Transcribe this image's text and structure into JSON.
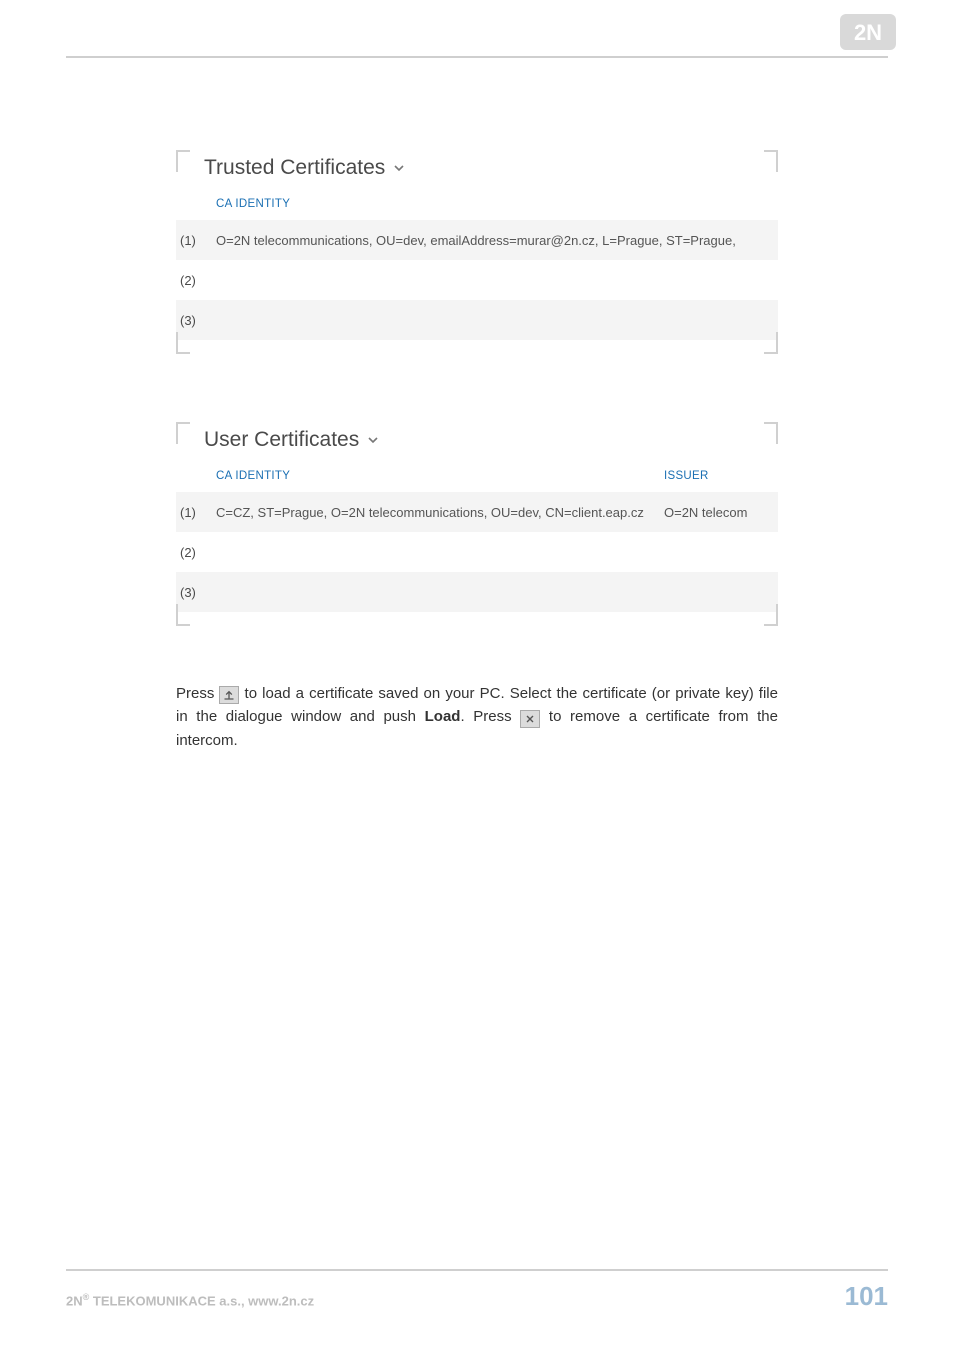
{
  "header": {
    "logo_text": "2N"
  },
  "panels": {
    "trusted": {
      "title": "Trusted Certificates",
      "columns": {
        "index": "",
        "ca_identity": "CA IDENTITY"
      },
      "rows": [
        {
          "idx": "(1)",
          "ca": "O=2N telecommunications, OU=dev, emailAddress=murar@2n.cz, L=Prague, ST=Prague,"
        },
        {
          "idx": "(2)",
          "ca": ""
        },
        {
          "idx": "(3)",
          "ca": ""
        }
      ]
    },
    "user": {
      "title": "User Certificates",
      "columns": {
        "index": "",
        "ca_identity": "CA IDENTITY",
        "issuer": "ISSUER"
      },
      "rows": [
        {
          "idx": "(1)",
          "ca": "C=CZ, ST=Prague, O=2N telecommunications, OU=dev, CN=client.eap.cz",
          "issuer": "O=2N telecom"
        },
        {
          "idx": "(2)",
          "ca": "",
          "issuer": ""
        },
        {
          "idx": "(3)",
          "ca": "",
          "issuer": ""
        }
      ]
    }
  },
  "body": {
    "t1": "Press ",
    "t2": " to load a certificate saved on your PC. Select the certificate (or private key) file in the dialogue window and push ",
    "load": "Load",
    "t3": ". Press ",
    "t4": " to remove a certificate from the intercom."
  },
  "icons": {
    "upload_name": "upload-icon",
    "remove_name": "close-icon",
    "chevron_name": "chevron-down-icon"
  },
  "footer": {
    "company_pre": "2N",
    "company_sup": "®",
    "company_post": " TELEKOMUNIKACE a.s., www.2n.cz",
    "page": "101"
  }
}
